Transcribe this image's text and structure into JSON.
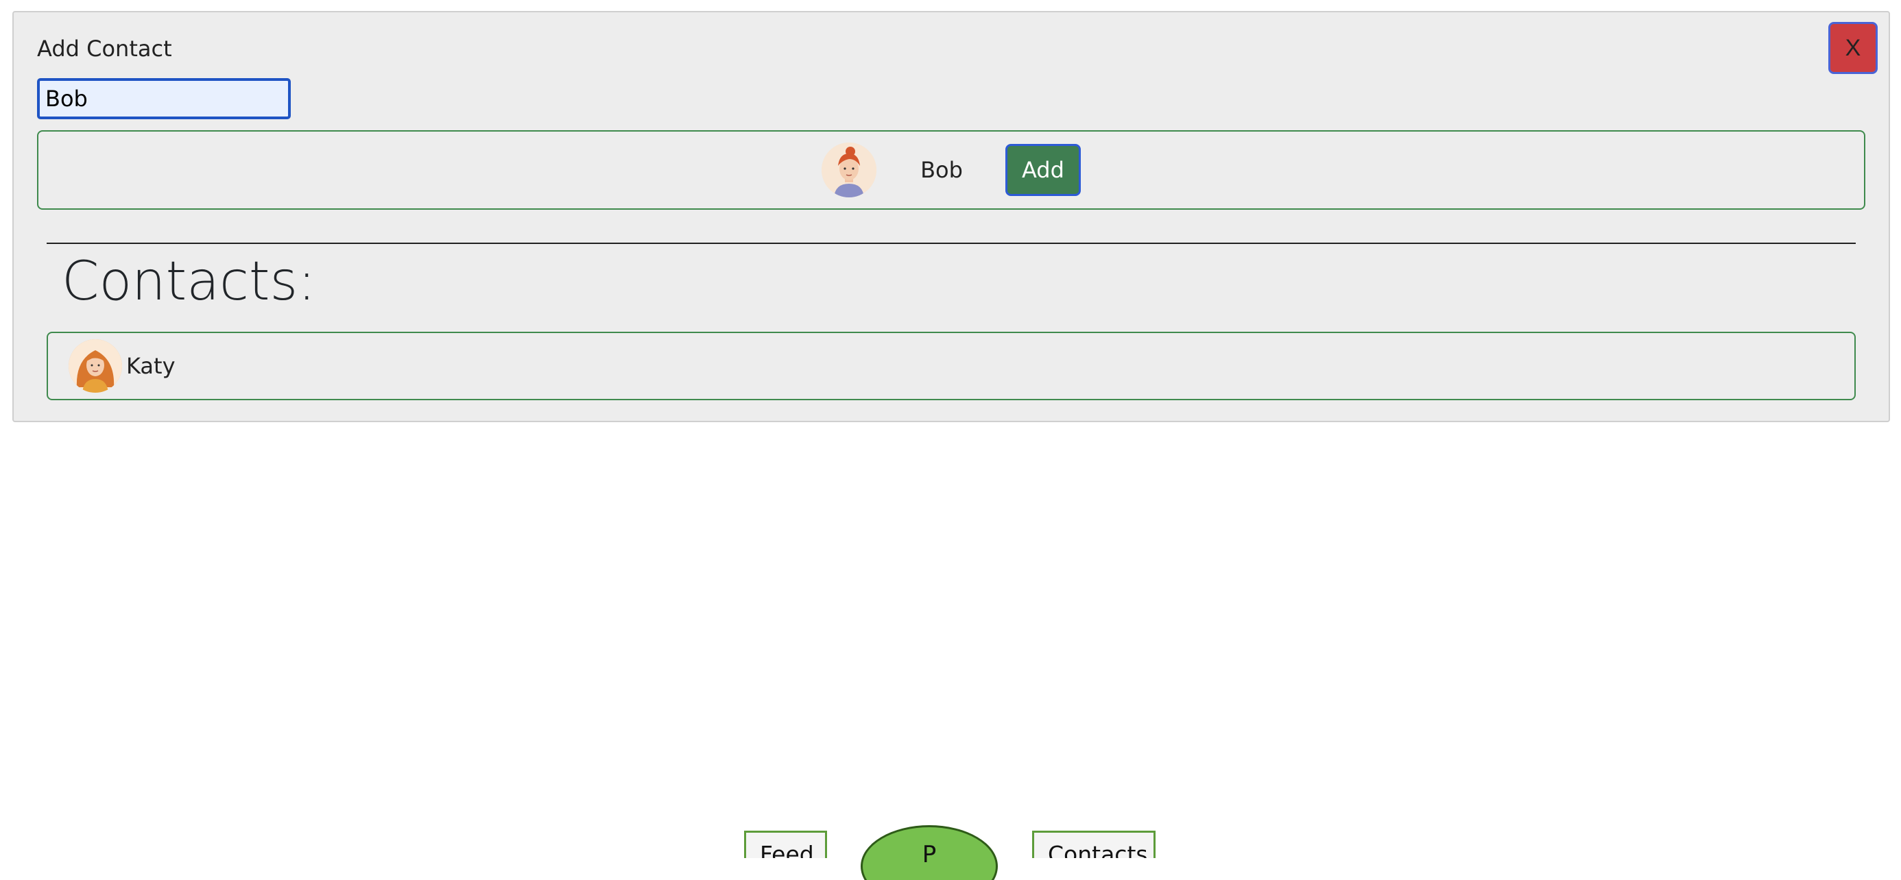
{
  "modal": {
    "title": "Add Contact",
    "close_label": "X",
    "search": {
      "value": "Bob",
      "placeholder": ""
    }
  },
  "search_results": [
    {
      "name": "Bob",
      "avatar": "avatar-woman-red-bun-icon",
      "action_label": "Add"
    }
  ],
  "contacts": {
    "heading": "Contacts:",
    "items": [
      {
        "name": "Katy",
        "avatar": "avatar-woman-long-hair-icon"
      }
    ]
  },
  "background_nav": {
    "tabs": [
      "Feed",
      "P",
      "Contacts"
    ]
  },
  "colors": {
    "close_button": "#cc3d40",
    "add_button": "#3f7e51",
    "card_border": "#3f8a4d",
    "modal_bg": "#ededed",
    "focus_border": "#1f54c4",
    "nav_green": "#77c04e"
  }
}
